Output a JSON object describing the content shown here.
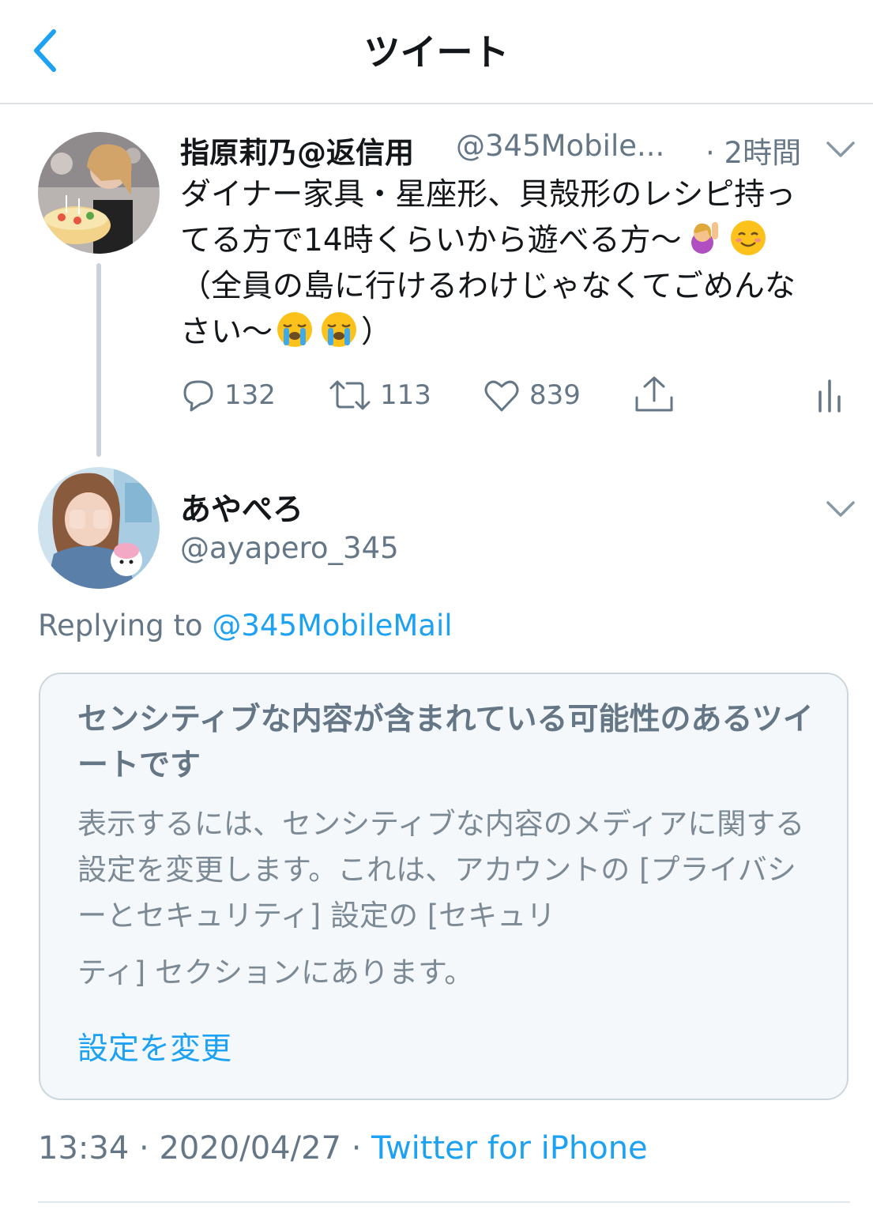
{
  "header": {
    "title": "ツイート"
  },
  "tweet1": {
    "display_name": "指原莉乃@返信用",
    "handle": "@345Mobile...",
    "time": "· 2時間",
    "text_line1": "ダイナー家具・星座形、貝殻形のレシピ持っ",
    "text_line2": "てる方で14時くらいから遊べる方〜",
    "text_line3": "（全員の島に行けるわけじゃなくてごめんな",
    "text_line4": "さい〜",
    "text_end": "）",
    "emojis": [
      "raising-hand-emoji",
      "smiling-blush-emoji",
      "crying-face-emoji",
      "crying-face-emoji"
    ],
    "actions": {
      "replies": "132",
      "retweets": "113",
      "likes": "839"
    }
  },
  "tweet2": {
    "display_name": "あやぺろ",
    "handle": "@ayapero_345",
    "replying_prefix": "Replying to ",
    "replying_handle": "@345MobileMail",
    "sensitive": {
      "title": "センシティブな内容が含まれている可能性のあるツイートです",
      "body1": "表示するには、センシティブな内容のメディアに関する設定を変更します。これは、アカウントの [プライバシーとセキュリティ] 設定の [セキュリ",
      "body2": "ティ] セクションにあります。",
      "action": "設定を変更"
    },
    "meta": {
      "time": "13:34",
      "sep1": " · ",
      "date": "2020/04/27",
      "sep2": " · ",
      "source": "Twitter for iPhone"
    }
  },
  "colors": {
    "accent": "#1da1f2",
    "muted": "#657786",
    "text": "#14171a",
    "card_bg": "#f5f8fa"
  }
}
